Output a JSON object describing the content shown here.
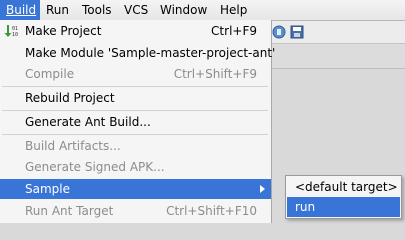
{
  "menubar": {
    "items": [
      {
        "label": "Build",
        "active": true
      },
      {
        "label": "Run"
      },
      {
        "label": "Tools"
      },
      {
        "label": "VCS"
      },
      {
        "label": "Window"
      },
      {
        "label": "Help"
      }
    ]
  },
  "build_menu": {
    "items": [
      {
        "label": "Make Project",
        "shortcut": "Ctrl+F9",
        "enabled": true,
        "icon": "make-project-icon"
      },
      {
        "label": "Make Module 'Sample-master-project-ant'",
        "shortcut": "",
        "enabled": true
      },
      {
        "label": "Compile",
        "shortcut": "Ctrl+Shift+F9",
        "enabled": false
      },
      {
        "label": "Rebuild Project",
        "shortcut": "",
        "enabled": true
      },
      {
        "label": "Generate Ant Build...",
        "shortcut": "",
        "enabled": true
      },
      {
        "label": "Build Artifacts...",
        "shortcut": "",
        "enabled": false
      },
      {
        "label": "Generate Signed APK...",
        "shortcut": "",
        "enabled": false
      },
      {
        "label": "Sample",
        "shortcut": "",
        "enabled": true,
        "selected": true,
        "submenu": true
      },
      {
        "label": "Run Ant Target",
        "shortcut": "Ctrl+Shift+F10",
        "enabled": false
      }
    ]
  },
  "sample_submenu": {
    "items": [
      {
        "label": "<default target>"
      },
      {
        "label": "run",
        "selected": true
      }
    ]
  },
  "toolbar_icons": [
    "debug-icon",
    "save-icon"
  ],
  "colors": {
    "selection": "#3875d7",
    "menu_bg": "#f5f5f5",
    "disabled_text": "#8c8c8c"
  }
}
